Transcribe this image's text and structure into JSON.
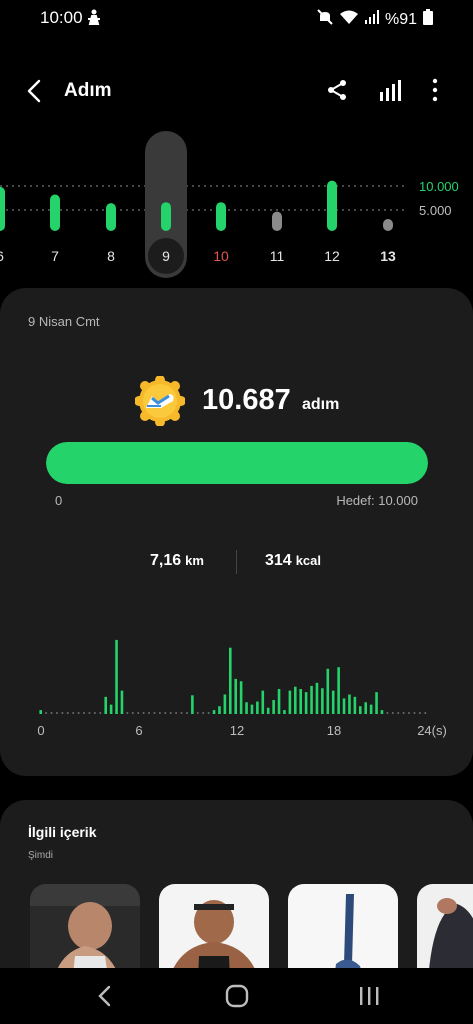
{
  "status": {
    "time": "10:00",
    "battery": "%91",
    "icons": [
      "person-icon",
      "mute-icon",
      "wifi-icon",
      "signal-icon",
      "battery-icon"
    ]
  },
  "header": {
    "title": "Adım",
    "icons": [
      "back-icon",
      "share-icon",
      "bar-chart-icon",
      "more-icon"
    ]
  },
  "daily_chart": {
    "days": [
      "6",
      "7",
      "8",
      "9",
      "10",
      "11",
      "12",
      "13"
    ],
    "selected_day": "9",
    "weekend_day": "10",
    "today": "13",
    "steps": [
      9800,
      8100,
      6200,
      6400,
      6400,
      4300,
      11200,
      1200
    ],
    "goal_line_label": "10.000",
    "half_line_label": "5.000",
    "colors": {
      "bar_goal": "#24d36a",
      "bar_low": "#8a8a8a",
      "weekend_label": "#e0544a"
    }
  },
  "summary": {
    "date": "9 Nisan Cmt",
    "steps": "10.687",
    "steps_unit": "adım",
    "progress": 1.0,
    "progress_min": "0",
    "progress_goal": "Hedef: 10.000",
    "distance": "7,16",
    "distance_unit": "km",
    "calories": "314",
    "calories_unit": "kcal",
    "badge_icon": "running-shoe-badge-icon",
    "accent": "#24d36a"
  },
  "chart_data": {
    "type": "bar",
    "x_labels": [
      "0",
      "6",
      "12",
      "18",
      "24(s)"
    ],
    "xlim": [
      0,
      24
    ],
    "values": [
      0.05,
      0,
      0,
      0,
      0,
      0,
      0,
      0,
      0,
      0,
      0,
      0,
      0.22,
      0.12,
      0.95,
      0.3,
      0,
      0,
      0,
      0,
      0,
      0,
      0,
      0,
      0,
      0,
      0,
      0,
      0.24,
      0,
      0,
      0,
      0.05,
      0.1,
      0.25,
      0.85,
      0.45,
      0.42,
      0.15,
      0.12,
      0.16,
      0.3,
      0.08,
      0.18,
      0.32,
      0.05,
      0.3,
      0.35,
      0.32,
      0.28,
      0.36,
      0.4,
      0.33,
      0.58,
      0.3,
      0.6,
      0.2,
      0.25,
      0.22,
      0.1,
      0.15,
      0.12,
      0.28,
      0.05,
      0,
      0,
      0,
      0,
      0,
      0,
      0,
      0
    ]
  },
  "related": {
    "title": "İlgili içerik",
    "subtitle": "Şimdi"
  },
  "nav": {
    "icons": [
      "nav-back-icon",
      "nav-home-icon",
      "nav-recent-icon"
    ]
  }
}
